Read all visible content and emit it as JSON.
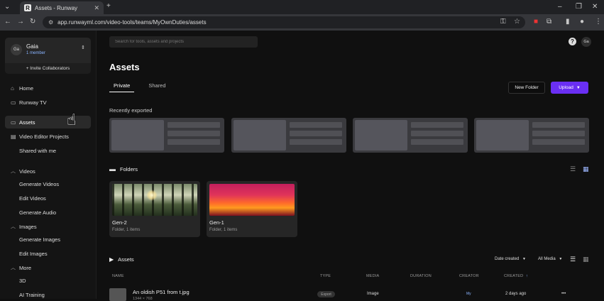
{
  "browser": {
    "tab_title": "Assets - Runway",
    "favicon_letter": "R",
    "url": "app.runwayml.com/video-tools/teams/MyOwnDuties/assets"
  },
  "team": {
    "avatar_initials": "Ga",
    "name": "Gaia",
    "members": "1 member",
    "invite_label": "+ Invite Collaborators"
  },
  "sidebar": {
    "top_items": [
      {
        "label": "Home",
        "icon": "home-icon"
      },
      {
        "label": "Runway TV",
        "icon": "tv-icon"
      }
    ],
    "asset_items": [
      {
        "label": "Assets",
        "icon": "folder-icon",
        "active": true
      },
      {
        "label": "Video Editor Projects",
        "icon": "film-icon"
      },
      {
        "label": "Shared with me",
        "icon": ""
      }
    ],
    "videos_section": "Videos",
    "videos_items": [
      "Generate Videos",
      "Edit Videos",
      "Generate Audio"
    ],
    "images_section": "Images",
    "images_items": [
      "Generate Images",
      "Edit Images"
    ],
    "more_section": "More",
    "more_items": [
      "3D",
      "AI Training"
    ]
  },
  "topbar": {
    "search_placeholder": "Search for tools, assets and projects",
    "help_label": "?",
    "user_initials": "Ga"
  },
  "page": {
    "title": "Assets",
    "tabs": [
      "Private",
      "Shared"
    ],
    "new_folder_label": "New Folder",
    "upload_label": "Upload",
    "recently_exported_label": "Recently exported",
    "folders_label": "Folders",
    "assets_label": "Assets"
  },
  "folders": [
    {
      "name": "Gen-2",
      "meta": "Folder, 1 items"
    },
    {
      "name": "Gen-1",
      "meta": "Folder, 1 items"
    }
  ],
  "assets_toolbar": {
    "sort_label": "Date created",
    "media_filter": "All Media"
  },
  "table": {
    "headers": [
      "NAME",
      "TYPE",
      "MEDIA",
      "DURATION",
      "CREATOR",
      "CREATED"
    ],
    "rows": [
      {
        "name": "An oldish P51 from t.jpg",
        "dimensions": "1344 × 768",
        "type": "Export",
        "media": "Image",
        "duration": "",
        "creator": "My",
        "created": "2 days ago",
        "actions": "•••"
      }
    ]
  },
  "colors": {
    "accent": "#6a2ff3",
    "background": "#101010",
    "sidebar": "#141414"
  }
}
